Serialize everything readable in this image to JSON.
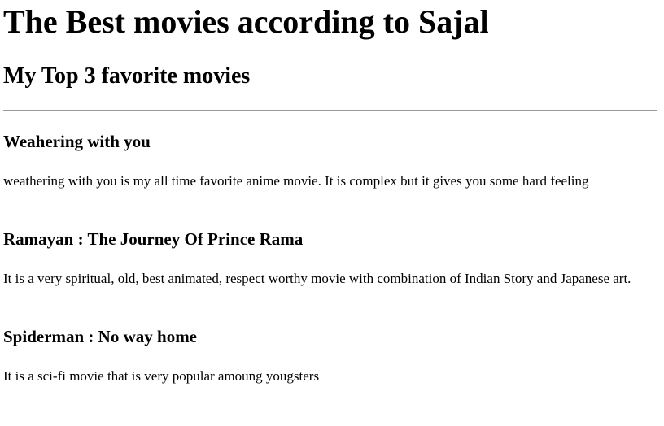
{
  "page": {
    "title": "The Best movies according to Sajal",
    "subtitle": "My Top 3 favorite movies"
  },
  "movies": [
    {
      "title": "Weahering with you",
      "description": "weathering with you is my all time favorite anime movie. It is complex but it gives you some hard feeling"
    },
    {
      "title": "Ramayan : The Journey Of Prince Rama",
      "description": "It is a very spiritual, old, best animated, respect worthy movie with combination of Indian Story and Japanese art."
    },
    {
      "title": "Spiderman : No way home",
      "description": "It is a sci-fi movie that is very popular amoung yougsters"
    }
  ]
}
